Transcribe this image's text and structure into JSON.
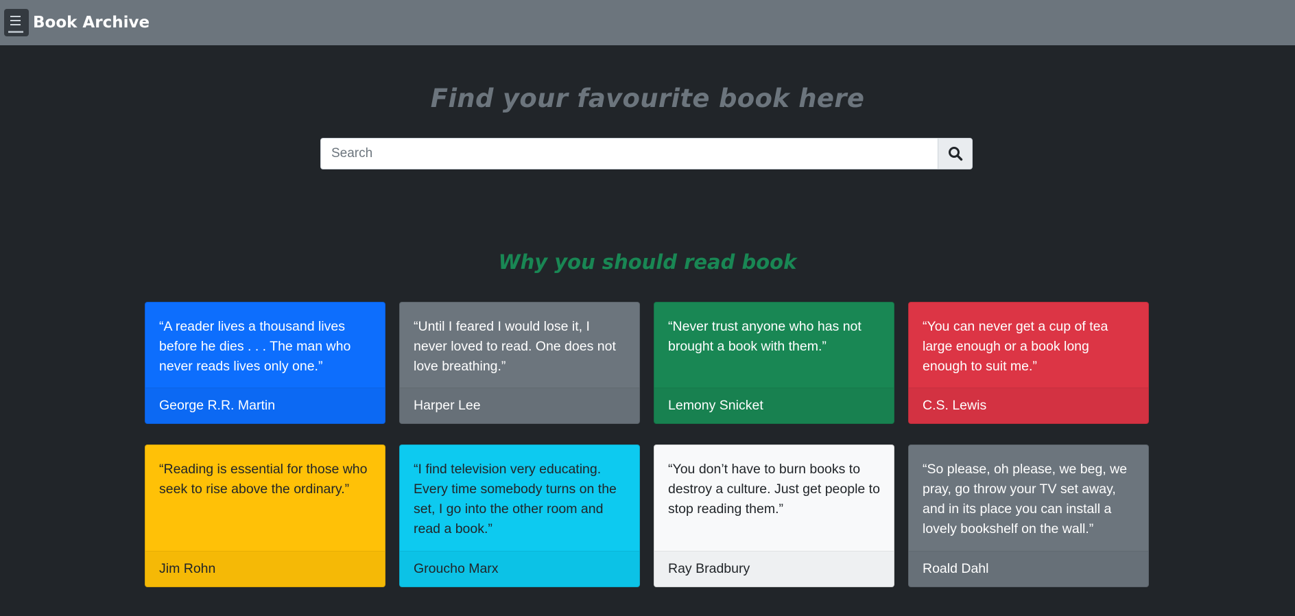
{
  "navbar": {
    "icon": "book-icon",
    "title": "Book Archive"
  },
  "hero": {
    "title": "Find your favourite book here"
  },
  "search": {
    "placeholder": "Search",
    "value": "",
    "button_icon": "search-icon"
  },
  "quotes_section": {
    "title": "Why you should read book",
    "cards": [
      {
        "quote": "“A reader lives a thousand lives before he dies . . . The man who never reads lives only one.”",
        "author": "George R.R. Martin",
        "color": "#0d6efd"
      },
      {
        "quote": "“Until I feared I would lose it, I never loved to read. One does not love breathing.”",
        "author": "Harper Lee",
        "color": "#6c757d"
      },
      {
        "quote": "“Never trust anyone who has not brought a book with them.”",
        "author": "Lemony Snicket",
        "color": "#198754"
      },
      {
        "quote": "“You can never get a cup of tea large enough or a book long enough to suit me.”",
        "author": "C.S. Lewis",
        "color": "#dc3545"
      },
      {
        "quote": "“Reading is essential for those who seek to rise above the ordinary.”",
        "author": "Jim Rohn",
        "color": "#ffc107"
      },
      {
        "quote": "“I find television very educating. Every time somebody turns on the set, I go into the other room and read a book.”",
        "author": "Groucho Marx",
        "color": "#0dcaf0"
      },
      {
        "quote": "“You don’t have to burn books to destroy a culture. Just get people to stop reading them.”",
        "author": "Ray Bradbury",
        "color": "#f8f9fa"
      },
      {
        "quote": "“So please, oh please, we beg, we pray, go throw your TV set away, and in its place you can install a lovely bookshelf on the wall.”",
        "author": "Roald Dahl",
        "color": "#6c757d"
      }
    ]
  }
}
